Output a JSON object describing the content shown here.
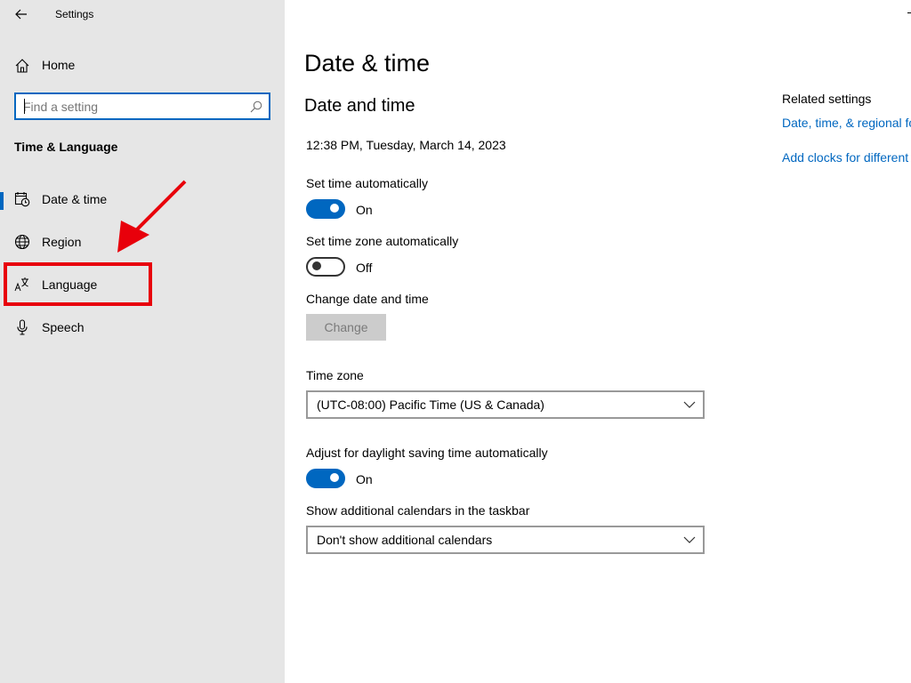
{
  "window": {
    "title": "Settings"
  },
  "sidebar": {
    "home_label": "Home",
    "search": {
      "placeholder": "Find a setting",
      "value": ""
    },
    "section_title": "Time & Language",
    "items": [
      {
        "label": "Date & time",
        "icon": "calendar-clock-icon",
        "selected": true
      },
      {
        "label": "Region",
        "icon": "globe-icon",
        "selected": false
      },
      {
        "label": "Language",
        "icon": "language-icon",
        "selected": false
      },
      {
        "label": "Speech",
        "icon": "microphone-icon",
        "selected": false
      }
    ]
  },
  "main": {
    "page_title": "Date & time",
    "section_title": "Date and time",
    "current_datetime": "12:38 PM, Tuesday, March 14, 2023",
    "set_time_auto": {
      "label": "Set time automatically",
      "state": "On"
    },
    "set_timezone_auto": {
      "label": "Set time zone automatically",
      "state": "Off"
    },
    "change_date_time": {
      "label": "Change date and time",
      "button": "Change"
    },
    "time_zone": {
      "label": "Time zone",
      "value": "(UTC-08:00) Pacific Time (US & Canada)"
    },
    "daylight_saving": {
      "label": "Adjust for daylight saving time automatically",
      "state": "On"
    },
    "additional_calendars": {
      "label": "Show additional calendars in the taskbar",
      "value": "Don't show additional calendars"
    }
  },
  "related": {
    "title": "Related settings",
    "links": [
      "Date, time, & regional fo",
      "Add clocks for different"
    ]
  },
  "colors": {
    "accent": "#0067c0",
    "sidebar_bg": "#e6e6e6",
    "annotation": "#e8000b"
  }
}
